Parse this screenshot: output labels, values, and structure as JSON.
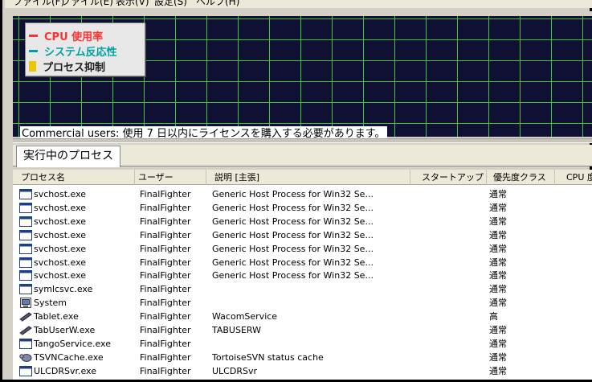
{
  "menubar": {
    "items": [
      "ファイル(F)",
      "ファイル(E)",
      "表示(V)",
      "設定(S)",
      "ヘルプ(H)"
    ]
  },
  "legend": {
    "items": [
      {
        "label": "CPU 使用率",
        "color": "#ff3030",
        "swatch": "line"
      },
      {
        "label": "システム反応性",
        "color": "#00a0a0",
        "swatch": "line"
      },
      {
        "label": "プロセス抑制",
        "color": "#e8c800",
        "swatch": "box"
      }
    ]
  },
  "banner": {
    "text": "Commercial users: 使用 7 日以内にライセンスを購入する必要があります。"
  },
  "tabs": {
    "processes": "実行中のプロセス"
  },
  "table": {
    "columns": [
      "プロセス名",
      "ユーザー",
      "説明 [主張]",
      "スタートアップ",
      "優先度クラス",
      "CPU 度"
    ],
    "rows": [
      {
        "icon": "window-icon",
        "name": "svchost.exe",
        "user": "FinalFighter",
        "desc": "Generic Host Process for Win32 Se...",
        "priority": "通常"
      },
      {
        "icon": "window-icon",
        "name": "svchost.exe",
        "user": "FinalFighter",
        "desc": "Generic Host Process for Win32 Se...",
        "priority": "通常"
      },
      {
        "icon": "window-icon",
        "name": "svchost.exe",
        "user": "FinalFighter",
        "desc": "Generic Host Process for Win32 Se...",
        "priority": "通常"
      },
      {
        "icon": "window-icon",
        "name": "svchost.exe",
        "user": "FinalFighter",
        "desc": "Generic Host Process for Win32 Se...",
        "priority": "通常"
      },
      {
        "icon": "window-icon",
        "name": "svchost.exe",
        "user": "FinalFighter",
        "desc": "Generic Host Process for Win32 Se...",
        "priority": "通常"
      },
      {
        "icon": "window-icon",
        "name": "svchost.exe",
        "user": "FinalFighter",
        "desc": "Generic Host Process for Win32 Se...",
        "priority": "通常"
      },
      {
        "icon": "window-icon",
        "name": "svchost.exe",
        "user": "FinalFighter",
        "desc": "Generic Host Process for Win32 Se...",
        "priority": "通常"
      },
      {
        "icon": "window-icon",
        "name": "symlcsvc.exe",
        "user": "FinalFighter",
        "desc": "",
        "priority": "通常"
      },
      {
        "icon": "system-icon",
        "name": "System",
        "user": "FinalFighter",
        "desc": "",
        "priority": "通常"
      },
      {
        "icon": "tablet-icon",
        "name": "Tablet.exe",
        "user": "FinalFighter",
        "desc": "WacomService",
        "priority": "高"
      },
      {
        "icon": "tablet-icon",
        "name": "TabUserW.exe",
        "user": "FinalFighter",
        "desc": "TABUSERW",
        "priority": "通常"
      },
      {
        "icon": "window-icon",
        "name": "TangoService.exe",
        "user": "FinalFighter",
        "desc": "",
        "priority": "通常"
      },
      {
        "icon": "tortoise-icon",
        "name": "TSVNCache.exe",
        "user": "FinalFighter",
        "desc": "TortoiseSVN status cache",
        "priority": "通常"
      },
      {
        "icon": "window-icon",
        "name": "ULCDRSvr.exe",
        "user": "FinalFighter",
        "desc": "ULCDRSvr",
        "priority": "通常"
      }
    ]
  }
}
